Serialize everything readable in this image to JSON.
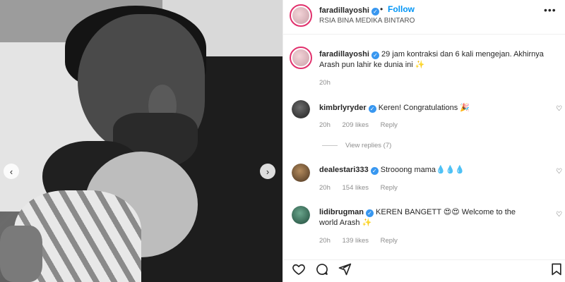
{
  "post": {
    "owner": "faradillayoshi",
    "follow_label": "Follow",
    "dot": "•",
    "location": "RSIA BINA MEDIKA BINTARO",
    "caption": "29 jam kontraksi dan 6 kali mengejan. Akhirnya Arash pun lahir ke dunia ini ✨",
    "caption_time": "20h"
  },
  "comments": [
    {
      "user": "kimbrlyryder",
      "text": "Keren! Congratulations 🎉",
      "time": "20h",
      "likes": "209 likes",
      "reply": "Reply",
      "view_replies": "View replies (7)"
    },
    {
      "user": "dealestari333",
      "text": "Strooong mama💧💧💧",
      "time": "20h",
      "likes": "154 likes",
      "reply": "Reply"
    },
    {
      "user": "lidibrugman",
      "text": "KEREN BANGETT 😍😍 Welcome to the world Arash ✨",
      "time": "20h",
      "likes": "139 likes",
      "reply": "Reply"
    }
  ],
  "icons": {
    "prev": "‹",
    "next": "›",
    "verified": "✓",
    "more": "•••",
    "heart": "♡"
  },
  "colors": {
    "accent": "#0095f6",
    "verified": "#3897f0",
    "muted": "#8e8e8e"
  }
}
